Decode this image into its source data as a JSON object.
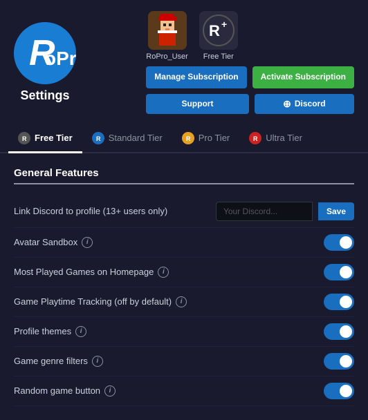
{
  "header": {
    "logo_alt": "RoPro Logo",
    "settings_label": "Settings"
  },
  "user": {
    "ropro_user": {
      "name": "RoPro_User",
      "avatar_alt": "RoPro User Avatar"
    },
    "free_tier": {
      "name": "Free Tier"
    },
    "buttons": {
      "manage_subscription": "Manage Subscription",
      "activate_subscription": "Activate Subscription",
      "support": "Support",
      "discord": "Discord"
    }
  },
  "tabs": [
    {
      "id": "free",
      "label": "Free Tier",
      "active": true,
      "icon_color": "#555"
    },
    {
      "id": "standard",
      "label": "Standard Tier",
      "active": false,
      "icon_color": "#1a6ebf"
    },
    {
      "id": "pro",
      "label": "Pro Tier",
      "active": false,
      "icon_color": "#e8a020"
    },
    {
      "id": "ultra",
      "label": "Ultra Tier",
      "active": false,
      "icon_color": "#cc2222"
    }
  ],
  "general_features": {
    "section_title": "General Features",
    "features": [
      {
        "id": "link-discord",
        "label": "Link Discord to profile (13+ users only)",
        "type": "input",
        "placeholder": "Your Discord...",
        "save_label": "Save",
        "has_info": false
      },
      {
        "id": "avatar-sandbox",
        "label": "Avatar Sandbox",
        "type": "toggle",
        "enabled": true,
        "has_info": true
      },
      {
        "id": "most-played-games",
        "label": "Most Played Games on Homepage",
        "type": "toggle",
        "enabled": true,
        "has_info": true
      },
      {
        "id": "game-playtime",
        "label": "Game Playtime Tracking (off by default)",
        "type": "toggle",
        "enabled": true,
        "has_info": true
      },
      {
        "id": "profile-themes",
        "label": "Profile themes",
        "type": "toggle",
        "enabled": true,
        "has_info": true
      },
      {
        "id": "game-genre",
        "label": "Game genre filters",
        "type": "toggle",
        "enabled": true,
        "has_info": true
      },
      {
        "id": "random-game",
        "label": "Random game button",
        "type": "toggle",
        "enabled": true,
        "has_info": true
      }
    ]
  },
  "icons": {
    "info": "i",
    "discord_glyph": "⊕"
  },
  "colors": {
    "accent_blue": "#1a6ebf",
    "accent_green": "#3cb043",
    "bg_dark": "#1a1a2e",
    "toggle_on": "#1a6ebf"
  }
}
